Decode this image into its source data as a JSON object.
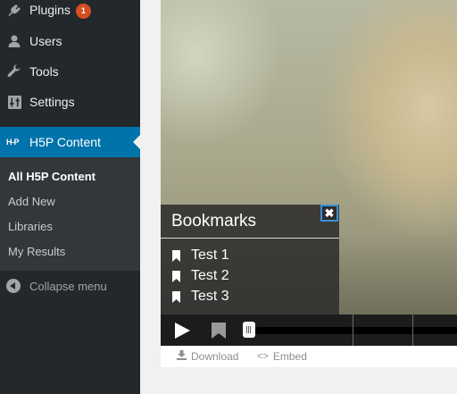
{
  "sidebar": {
    "items": [
      {
        "label": "Plugins",
        "icon": "plug-icon",
        "badge": "1"
      },
      {
        "label": "Users",
        "icon": "user-icon"
      },
      {
        "label": "Tools",
        "icon": "wrench-icon"
      },
      {
        "label": "Settings",
        "icon": "settings-sliders-icon"
      }
    ],
    "active": {
      "label": "H5P Content",
      "logo": "H-P"
    },
    "submenu": [
      "All H5P Content",
      "Add New",
      "Libraries",
      "My Results"
    ],
    "collapse_label": "Collapse menu"
  },
  "bookmarks": {
    "title": "Bookmarks",
    "close_glyph": "✖",
    "items": [
      "Test 1",
      "Test 2",
      "Test 3"
    ]
  },
  "player": {
    "footer": {
      "download_label": "Download",
      "embed_label": "Embed",
      "embed_glyph": "<>"
    }
  },
  "colors": {
    "sidebar_bg": "#23282d",
    "submenu_bg": "#32373c",
    "accent": "#0073aa",
    "badge": "#d54e21",
    "focus_outline": "#3b8fd6"
  }
}
